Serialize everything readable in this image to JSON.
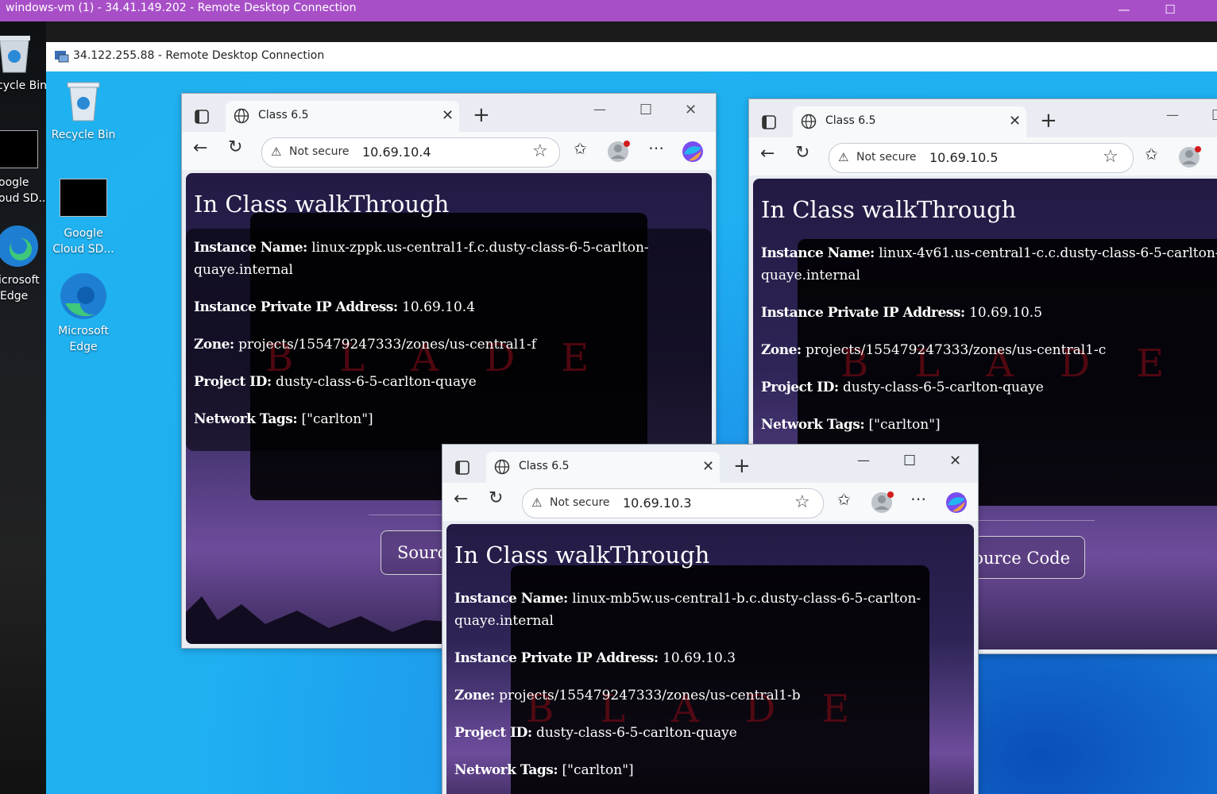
{
  "outer_window": {
    "title": "windows-vm (1) - 34.41.149.202 - Remote Desktop Connection",
    "accent": "#a84fc8"
  },
  "left_desktop": {
    "icons": [
      "cycle Bin",
      "oogle",
      "oud SD...",
      "icrosoft",
      "Edge"
    ]
  },
  "inner_window": {
    "title": "34.122.255.88 - Remote Desktop Connection"
  },
  "desktop_icons": [
    {
      "label": "Recycle Bin"
    },
    {
      "label": "Google Cloud SD..."
    },
    {
      "label": "Microsoft Edge"
    }
  ],
  "browsers": [
    {
      "tab_title": "Class 6.5",
      "not_secure": "Not secure",
      "url": "10.69.10.4",
      "heading": "In Class walkThrough",
      "fields": {
        "instance_name_label": "Instance Name:",
        "instance_name": "linux-zppk.us-central1-f.c.dusty-class-6-5-carlton-quaye.internal",
        "ip_label": "Instance Private IP Address:",
        "ip": "10.69.10.4",
        "zone_label": "Zone:",
        "zone": "projects/155479247333/zones/us-central1-f",
        "project_label": "Project ID:",
        "project": "dusty-class-6-5-carlton-quaye",
        "tags_label": "Network Tags:",
        "tags": "[\"carlton\"]"
      },
      "source_button": "Sourc"
    },
    {
      "tab_title": "Class 6.5",
      "not_secure": "Not secure",
      "url": "10.69.10.5",
      "heading": "In Class walkThrough",
      "fields": {
        "instance_name_label": "Instance Name:",
        "instance_name": "linux-4v61.us-central1-c.c.dusty-class-6-5-carlton-quaye.internal",
        "ip_label": "Instance Private IP Address:",
        "ip": "10.69.10.5",
        "zone_label": "Zone:",
        "zone": "projects/155479247333/zones/us-central1-c",
        "project_label": "Project ID:",
        "project": "dusty-class-6-5-carlton-quaye",
        "tags_label": "Network Tags:",
        "tags": "[\"carlton\"]"
      },
      "source_button": "ource Code"
    },
    {
      "tab_title": "Class 6.5",
      "not_secure": "Not secure",
      "url": "10.69.10.3",
      "heading": "In Class walkThrough",
      "fields": {
        "instance_name_label": "Instance Name:",
        "instance_name": "linux-mb5w.us-central1-b.c.dusty-class-6-5-carlton-quaye.internal",
        "ip_label": "Instance Private IP Address:",
        "ip": "10.69.10.3",
        "zone_label": "Zone:",
        "zone": "projects/155479247333/zones/us-central1-b",
        "project_label": "Project ID:",
        "project": "dusty-class-6-5-carlton-quaye",
        "tags_label": "Network Tags:",
        "tags": "[\"carlton\"]"
      }
    }
  ]
}
